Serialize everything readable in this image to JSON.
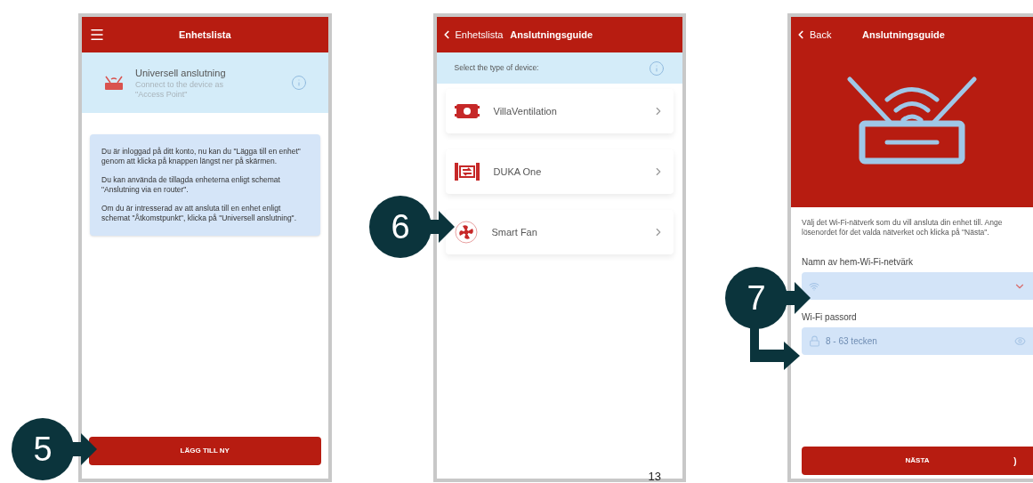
{
  "device_list_screen": {
    "title": "Enhetslista",
    "universal": {
      "title": "Universell anslutning",
      "subtitle": "Connect to the device as \"Access Point\""
    },
    "info_paragraphs": [
      "Du är inloggad på ditt konto, nu kan du \"Lägga till en enhet\" genom att klicka på knappen längst ner på skärmen.",
      "Du kan använda de tillagda enheterna enligt schemat \"Anslutning via en router\".",
      "Om du är intresserad av att ansluta till en enhet enligt schemat \"Åtkomstpunkt\", klicka på \"Universell anslutning\"."
    ],
    "add_button": "LÄGG TILL NY"
  },
  "device_type_screen": {
    "back": "Enhetslista",
    "title": "Anslutningsguide",
    "prompt": "Select the type of device:",
    "devices": [
      {
        "kind": "villa",
        "name": "VillaVentilation"
      },
      {
        "kind": "duka",
        "name": "DUKA One"
      },
      {
        "kind": "fan",
        "name": "Smart Fan"
      }
    ]
  },
  "wifi_screen": {
    "back": "Back",
    "title": "Anslutningsguide",
    "instructions": "Välj det Wi-Fi-nätverk som du vill ansluta din enhet till. Ange lösenordet för det valda nätverket och klicka på \"Nästa\".",
    "network_label": "Namn av hem-Wi-Fi-netvärk",
    "password_label": "Wi-Fi passord",
    "password_placeholder": "8 - 63 tecken",
    "next_button": "NÄSTA",
    "next_arrow": ")"
  },
  "callouts": [
    "5",
    "6",
    "7"
  ],
  "page_number": "13"
}
